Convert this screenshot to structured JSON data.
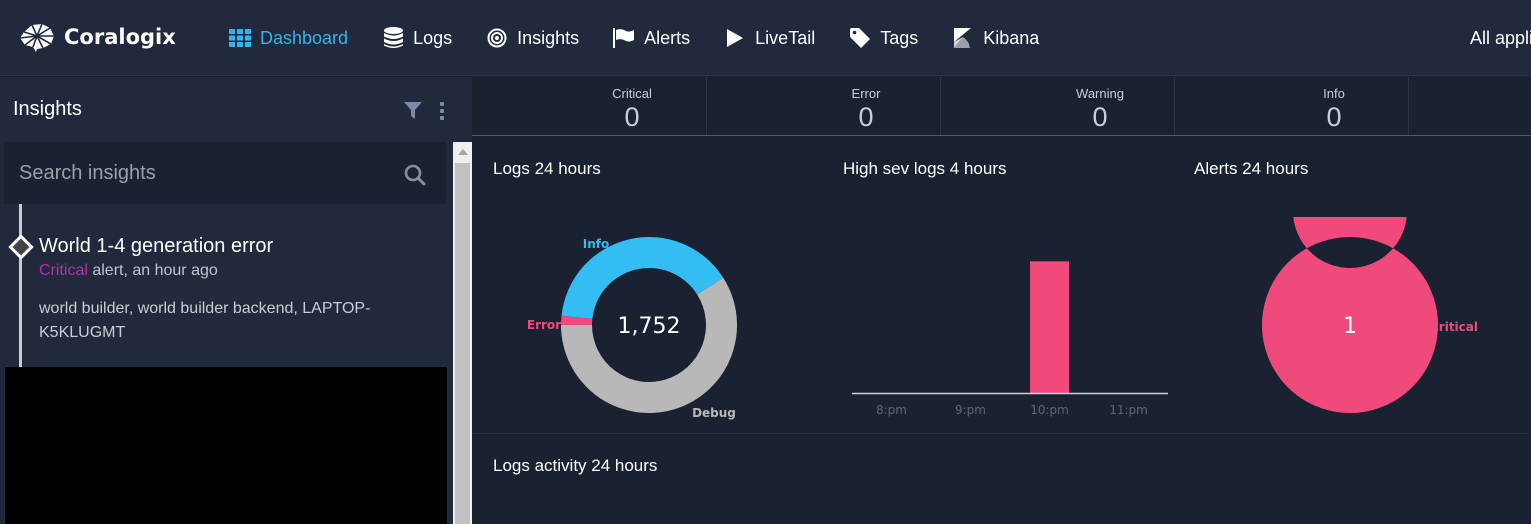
{
  "brand": {
    "name": "Coralogix",
    "accent": "#33b4f0"
  },
  "nav": {
    "items": [
      {
        "label": "Dashboard",
        "icon": "grid-icon",
        "active": true
      },
      {
        "label": "Logs",
        "icon": "database-icon",
        "active": false
      },
      {
        "label": "Insights",
        "icon": "target-icon",
        "active": false
      },
      {
        "label": "Alerts",
        "icon": "flag-icon",
        "active": false
      },
      {
        "label": "LiveTail",
        "icon": "play-icon",
        "active": false
      },
      {
        "label": "Tags",
        "icon": "tag-icon",
        "active": false
      },
      {
        "label": "Kibana",
        "icon": "kibana-icon",
        "active": false
      }
    ],
    "app_selector": "All appli"
  },
  "sidebar": {
    "title": "Insights",
    "search_placeholder": "Search insights",
    "insights": [
      {
        "title": "World 1-4 generation error",
        "severity": "Critical",
        "severity_color": "#b52fb0",
        "meta_rest": " alert, an hour ago",
        "tags": "world builder, world builder backend, LAPTOP-K5KLUGMT"
      }
    ]
  },
  "stats": [
    {
      "label": "Critical",
      "value": "0"
    },
    {
      "label": "Error",
      "value": "0"
    },
    {
      "label": "Warning",
      "value": "0"
    },
    {
      "label": "Info",
      "value": "0"
    }
  ],
  "panels": {
    "logs24": {
      "title": "Logs 24 hours"
    },
    "highsev": {
      "title": "High sev logs 4 hours"
    },
    "alerts24": {
      "title": "Alerts 24 hours"
    },
    "activity": {
      "title": "Logs activity 24 hours"
    }
  },
  "chart_data": [
    {
      "type": "pie",
      "title": "Logs 24 hours",
      "center_label": "1,752",
      "total": 1752,
      "slices": [
        {
          "label": "Info",
          "value": 689,
          "color": "#33bdf2"
        },
        {
          "label": "Debug",
          "value": 1034,
          "color": "#b8b8b8"
        },
        {
          "label": "Error",
          "value": 29,
          "color": "#f0497b"
        }
      ]
    },
    {
      "type": "bar",
      "title": "High sev logs 4 hours",
      "categories": [
        "8:pm",
        "9:pm",
        "10:pm",
        "11:pm"
      ],
      "values": [
        0,
        0,
        1,
        0
      ],
      "ylim": [
        0,
        1.2
      ],
      "color": "#f0497b",
      "xlabel": "",
      "ylabel": ""
    },
    {
      "type": "pie",
      "title": "Alerts 24 hours",
      "center_label": "1",
      "total": 1,
      "slices": [
        {
          "label": "Critical",
          "value": 1,
          "color": "#f0497b"
        }
      ]
    }
  ]
}
